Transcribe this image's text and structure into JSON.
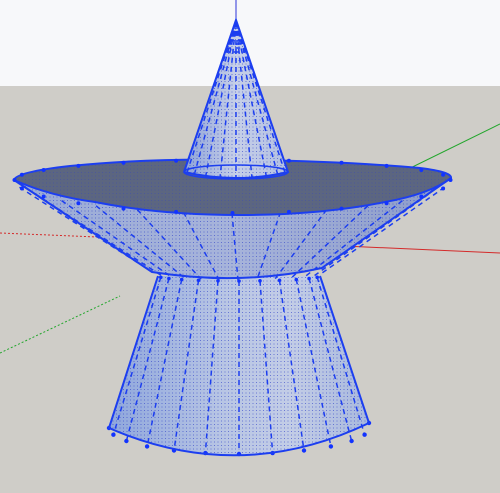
{
  "viewport": {
    "sky_color": "#f7f8fa",
    "ground_color": "#cfcdc8",
    "axes": {
      "red_color": "#d42a2a",
      "green_color": "#22a62c",
      "blue_color": "#2c35d8"
    },
    "selection": {
      "edge_color": "#1c3ef0",
      "vertex_color": "#1233ff",
      "fill_dot_color": "#2f40c8"
    },
    "model": {
      "name": "selected-stacked-cone-model",
      "parts": [
        "top-cone",
        "saucer-disk",
        "base-frustum"
      ]
    }
  }
}
